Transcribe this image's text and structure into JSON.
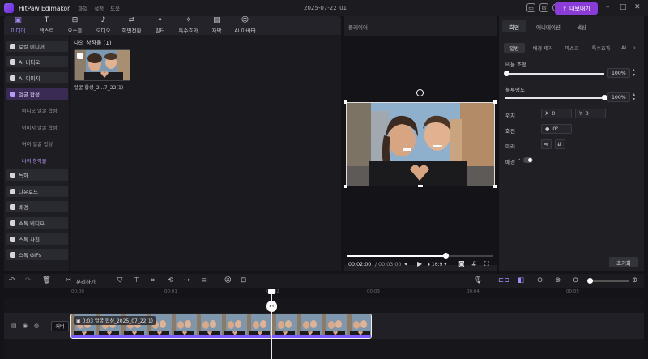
{
  "app": {
    "title": "HitPaw Edimakor",
    "menus": [
      "파일",
      "설정",
      "도움"
    ],
    "window_title": "2025-07-22_01",
    "export_label": "내보내기"
  },
  "toolbar": {
    "tools": [
      "미디어",
      "텍스트",
      "요소들",
      "오디오",
      "화면전환",
      "필터",
      "특수효과",
      "자막",
      "AI 아바타"
    ]
  },
  "left_nav": {
    "items": [
      "로컬 미디어",
      "AI 비디오",
      "AI 이미지",
      "얼굴 합성"
    ],
    "sub_items": [
      "비디오 얼굴 합성",
      "이미지 얼굴 합성",
      "여러 얼굴 합성",
      "나의 창작물"
    ],
    "items2": [
      "녹화",
      "다운로드",
      "배경",
      "스톡 비디오",
      "스톡 사진",
      "스톡 GIFs"
    ]
  },
  "media": {
    "title": "나의 창작물 (1)",
    "thumb_label": "얼굴 합성_2...7_22(1)"
  },
  "preview": {
    "title": "플레이어",
    "time_current": "00:02:00",
    "time_total": "00:03:00",
    "ratio": "16:9",
    "progress": 0.67
  },
  "props": {
    "tabs": [
      "화면",
      "애니메이션",
      "색상"
    ],
    "subtabs": [
      "일반",
      "배경 제거",
      "마스크",
      "특수효과",
      "AI"
    ],
    "scale_label": "비율 조정",
    "scale_value": "100%",
    "scale": 1.0,
    "opacity_label": "불투명도",
    "opacity_value": "100%",
    "opacity": 1.0,
    "position_label": "위치",
    "pos_x_label": "X",
    "pos_x": "0",
    "pos_y_label": "Y",
    "pos_y": "0",
    "rotate_label": "회전",
    "rotate_value": "0°",
    "mirror_label": "미러",
    "bg_label": "배경",
    "reset_label": "초기화"
  },
  "timeline": {
    "split_label": "분리하기",
    "ruler": [
      "00:00",
      "00:01",
      "00:02",
      "00:03",
      "00:04",
      "00:05"
    ],
    "cover_label": "커버",
    "clip_label": "0:03 얼굴 합성_2025_07_22(1)"
  }
}
